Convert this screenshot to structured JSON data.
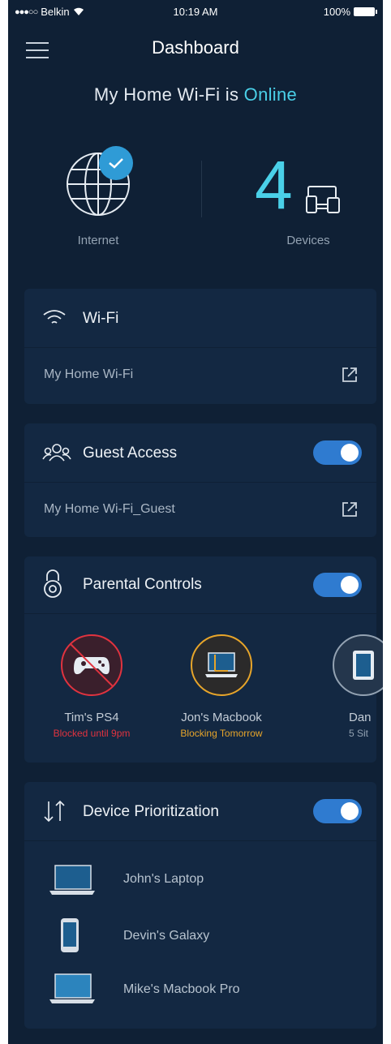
{
  "status_bar": {
    "carrier": "Belkin",
    "time": "10:19 AM",
    "battery": "100%"
  },
  "header": {
    "title": "Dashboard"
  },
  "status_line": {
    "prefix": "My Home Wi-Fi is ",
    "state": "Online"
  },
  "stats": {
    "internet_label": "Internet",
    "devices_count": "4",
    "devices_label": "Devices"
  },
  "wifi": {
    "title": "Wi-Fi",
    "network": "My Home Wi-Fi"
  },
  "guest": {
    "title": "Guest Access",
    "network": "My Home Wi-Fi_Guest",
    "enabled": true
  },
  "parental": {
    "title": "Parental Controls",
    "enabled": true,
    "devices": [
      {
        "name": "Tim's PS4",
        "status": "Blocked until 9pm",
        "status_color": "#e0333f"
      },
      {
        "name": "Jon's Macbook",
        "status": "Blocking Tomorrow",
        "status_color": "#e7a52a"
      },
      {
        "name": "Dan",
        "status": "5 Sit",
        "status_color": "#93a2b2"
      }
    ]
  },
  "prioritization": {
    "title": "Device Prioritization",
    "enabled": true,
    "devices": [
      {
        "name": "John's Laptop"
      },
      {
        "name": "Devin's Galaxy"
      },
      {
        "name": "Mike's Macbook Pro"
      }
    ]
  },
  "colors": {
    "background": "#0f2035",
    "card": "#132842",
    "accent": "#4ad0e8",
    "toggle": "#2f7bd0"
  }
}
